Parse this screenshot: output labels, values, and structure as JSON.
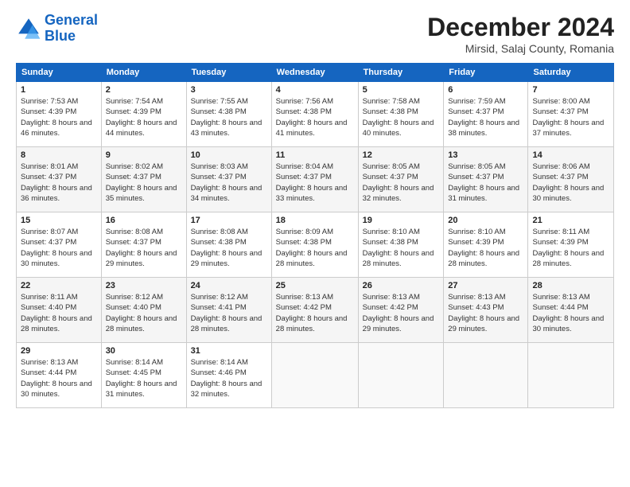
{
  "logo": {
    "line1": "General",
    "line2": "Blue"
  },
  "header": {
    "month": "December 2024",
    "location": "Mirsid, Salaj County, Romania"
  },
  "weekdays": [
    "Sunday",
    "Monday",
    "Tuesday",
    "Wednesday",
    "Thursday",
    "Friday",
    "Saturday"
  ],
  "weeks": [
    [
      {
        "day": "1",
        "sunrise": "Sunrise: 7:53 AM",
        "sunset": "Sunset: 4:39 PM",
        "daylight": "Daylight: 8 hours and 46 minutes."
      },
      {
        "day": "2",
        "sunrise": "Sunrise: 7:54 AM",
        "sunset": "Sunset: 4:39 PM",
        "daylight": "Daylight: 8 hours and 44 minutes."
      },
      {
        "day": "3",
        "sunrise": "Sunrise: 7:55 AM",
        "sunset": "Sunset: 4:38 PM",
        "daylight": "Daylight: 8 hours and 43 minutes."
      },
      {
        "day": "4",
        "sunrise": "Sunrise: 7:56 AM",
        "sunset": "Sunset: 4:38 PM",
        "daylight": "Daylight: 8 hours and 41 minutes."
      },
      {
        "day": "5",
        "sunrise": "Sunrise: 7:58 AM",
        "sunset": "Sunset: 4:38 PM",
        "daylight": "Daylight: 8 hours and 40 minutes."
      },
      {
        "day": "6",
        "sunrise": "Sunrise: 7:59 AM",
        "sunset": "Sunset: 4:37 PM",
        "daylight": "Daylight: 8 hours and 38 minutes."
      },
      {
        "day": "7",
        "sunrise": "Sunrise: 8:00 AM",
        "sunset": "Sunset: 4:37 PM",
        "daylight": "Daylight: 8 hours and 37 minutes."
      }
    ],
    [
      {
        "day": "8",
        "sunrise": "Sunrise: 8:01 AM",
        "sunset": "Sunset: 4:37 PM",
        "daylight": "Daylight: 8 hours and 36 minutes."
      },
      {
        "day": "9",
        "sunrise": "Sunrise: 8:02 AM",
        "sunset": "Sunset: 4:37 PM",
        "daylight": "Daylight: 8 hours and 35 minutes."
      },
      {
        "day": "10",
        "sunrise": "Sunrise: 8:03 AM",
        "sunset": "Sunset: 4:37 PM",
        "daylight": "Daylight: 8 hours and 34 minutes."
      },
      {
        "day": "11",
        "sunrise": "Sunrise: 8:04 AM",
        "sunset": "Sunset: 4:37 PM",
        "daylight": "Daylight: 8 hours and 33 minutes."
      },
      {
        "day": "12",
        "sunrise": "Sunrise: 8:05 AM",
        "sunset": "Sunset: 4:37 PM",
        "daylight": "Daylight: 8 hours and 32 minutes."
      },
      {
        "day": "13",
        "sunrise": "Sunrise: 8:05 AM",
        "sunset": "Sunset: 4:37 PM",
        "daylight": "Daylight: 8 hours and 31 minutes."
      },
      {
        "day": "14",
        "sunrise": "Sunrise: 8:06 AM",
        "sunset": "Sunset: 4:37 PM",
        "daylight": "Daylight: 8 hours and 30 minutes."
      }
    ],
    [
      {
        "day": "15",
        "sunrise": "Sunrise: 8:07 AM",
        "sunset": "Sunset: 4:37 PM",
        "daylight": "Daylight: 8 hours and 30 minutes."
      },
      {
        "day": "16",
        "sunrise": "Sunrise: 8:08 AM",
        "sunset": "Sunset: 4:37 PM",
        "daylight": "Daylight: 8 hours and 29 minutes."
      },
      {
        "day": "17",
        "sunrise": "Sunrise: 8:08 AM",
        "sunset": "Sunset: 4:38 PM",
        "daylight": "Daylight: 8 hours and 29 minutes."
      },
      {
        "day": "18",
        "sunrise": "Sunrise: 8:09 AM",
        "sunset": "Sunset: 4:38 PM",
        "daylight": "Daylight: 8 hours and 28 minutes."
      },
      {
        "day": "19",
        "sunrise": "Sunrise: 8:10 AM",
        "sunset": "Sunset: 4:38 PM",
        "daylight": "Daylight: 8 hours and 28 minutes."
      },
      {
        "day": "20",
        "sunrise": "Sunrise: 8:10 AM",
        "sunset": "Sunset: 4:39 PM",
        "daylight": "Daylight: 8 hours and 28 minutes."
      },
      {
        "day": "21",
        "sunrise": "Sunrise: 8:11 AM",
        "sunset": "Sunset: 4:39 PM",
        "daylight": "Daylight: 8 hours and 28 minutes."
      }
    ],
    [
      {
        "day": "22",
        "sunrise": "Sunrise: 8:11 AM",
        "sunset": "Sunset: 4:40 PM",
        "daylight": "Daylight: 8 hours and 28 minutes."
      },
      {
        "day": "23",
        "sunrise": "Sunrise: 8:12 AM",
        "sunset": "Sunset: 4:40 PM",
        "daylight": "Daylight: 8 hours and 28 minutes."
      },
      {
        "day": "24",
        "sunrise": "Sunrise: 8:12 AM",
        "sunset": "Sunset: 4:41 PM",
        "daylight": "Daylight: 8 hours and 28 minutes."
      },
      {
        "day": "25",
        "sunrise": "Sunrise: 8:13 AM",
        "sunset": "Sunset: 4:42 PM",
        "daylight": "Daylight: 8 hours and 28 minutes."
      },
      {
        "day": "26",
        "sunrise": "Sunrise: 8:13 AM",
        "sunset": "Sunset: 4:42 PM",
        "daylight": "Daylight: 8 hours and 29 minutes."
      },
      {
        "day": "27",
        "sunrise": "Sunrise: 8:13 AM",
        "sunset": "Sunset: 4:43 PM",
        "daylight": "Daylight: 8 hours and 29 minutes."
      },
      {
        "day": "28",
        "sunrise": "Sunrise: 8:13 AM",
        "sunset": "Sunset: 4:44 PM",
        "daylight": "Daylight: 8 hours and 30 minutes."
      }
    ],
    [
      {
        "day": "29",
        "sunrise": "Sunrise: 8:13 AM",
        "sunset": "Sunset: 4:44 PM",
        "daylight": "Daylight: 8 hours and 30 minutes."
      },
      {
        "day": "30",
        "sunrise": "Sunrise: 8:14 AM",
        "sunset": "Sunset: 4:45 PM",
        "daylight": "Daylight: 8 hours and 31 minutes."
      },
      {
        "day": "31",
        "sunrise": "Sunrise: 8:14 AM",
        "sunset": "Sunset: 4:46 PM",
        "daylight": "Daylight: 8 hours and 32 minutes."
      },
      null,
      null,
      null,
      null
    ]
  ]
}
